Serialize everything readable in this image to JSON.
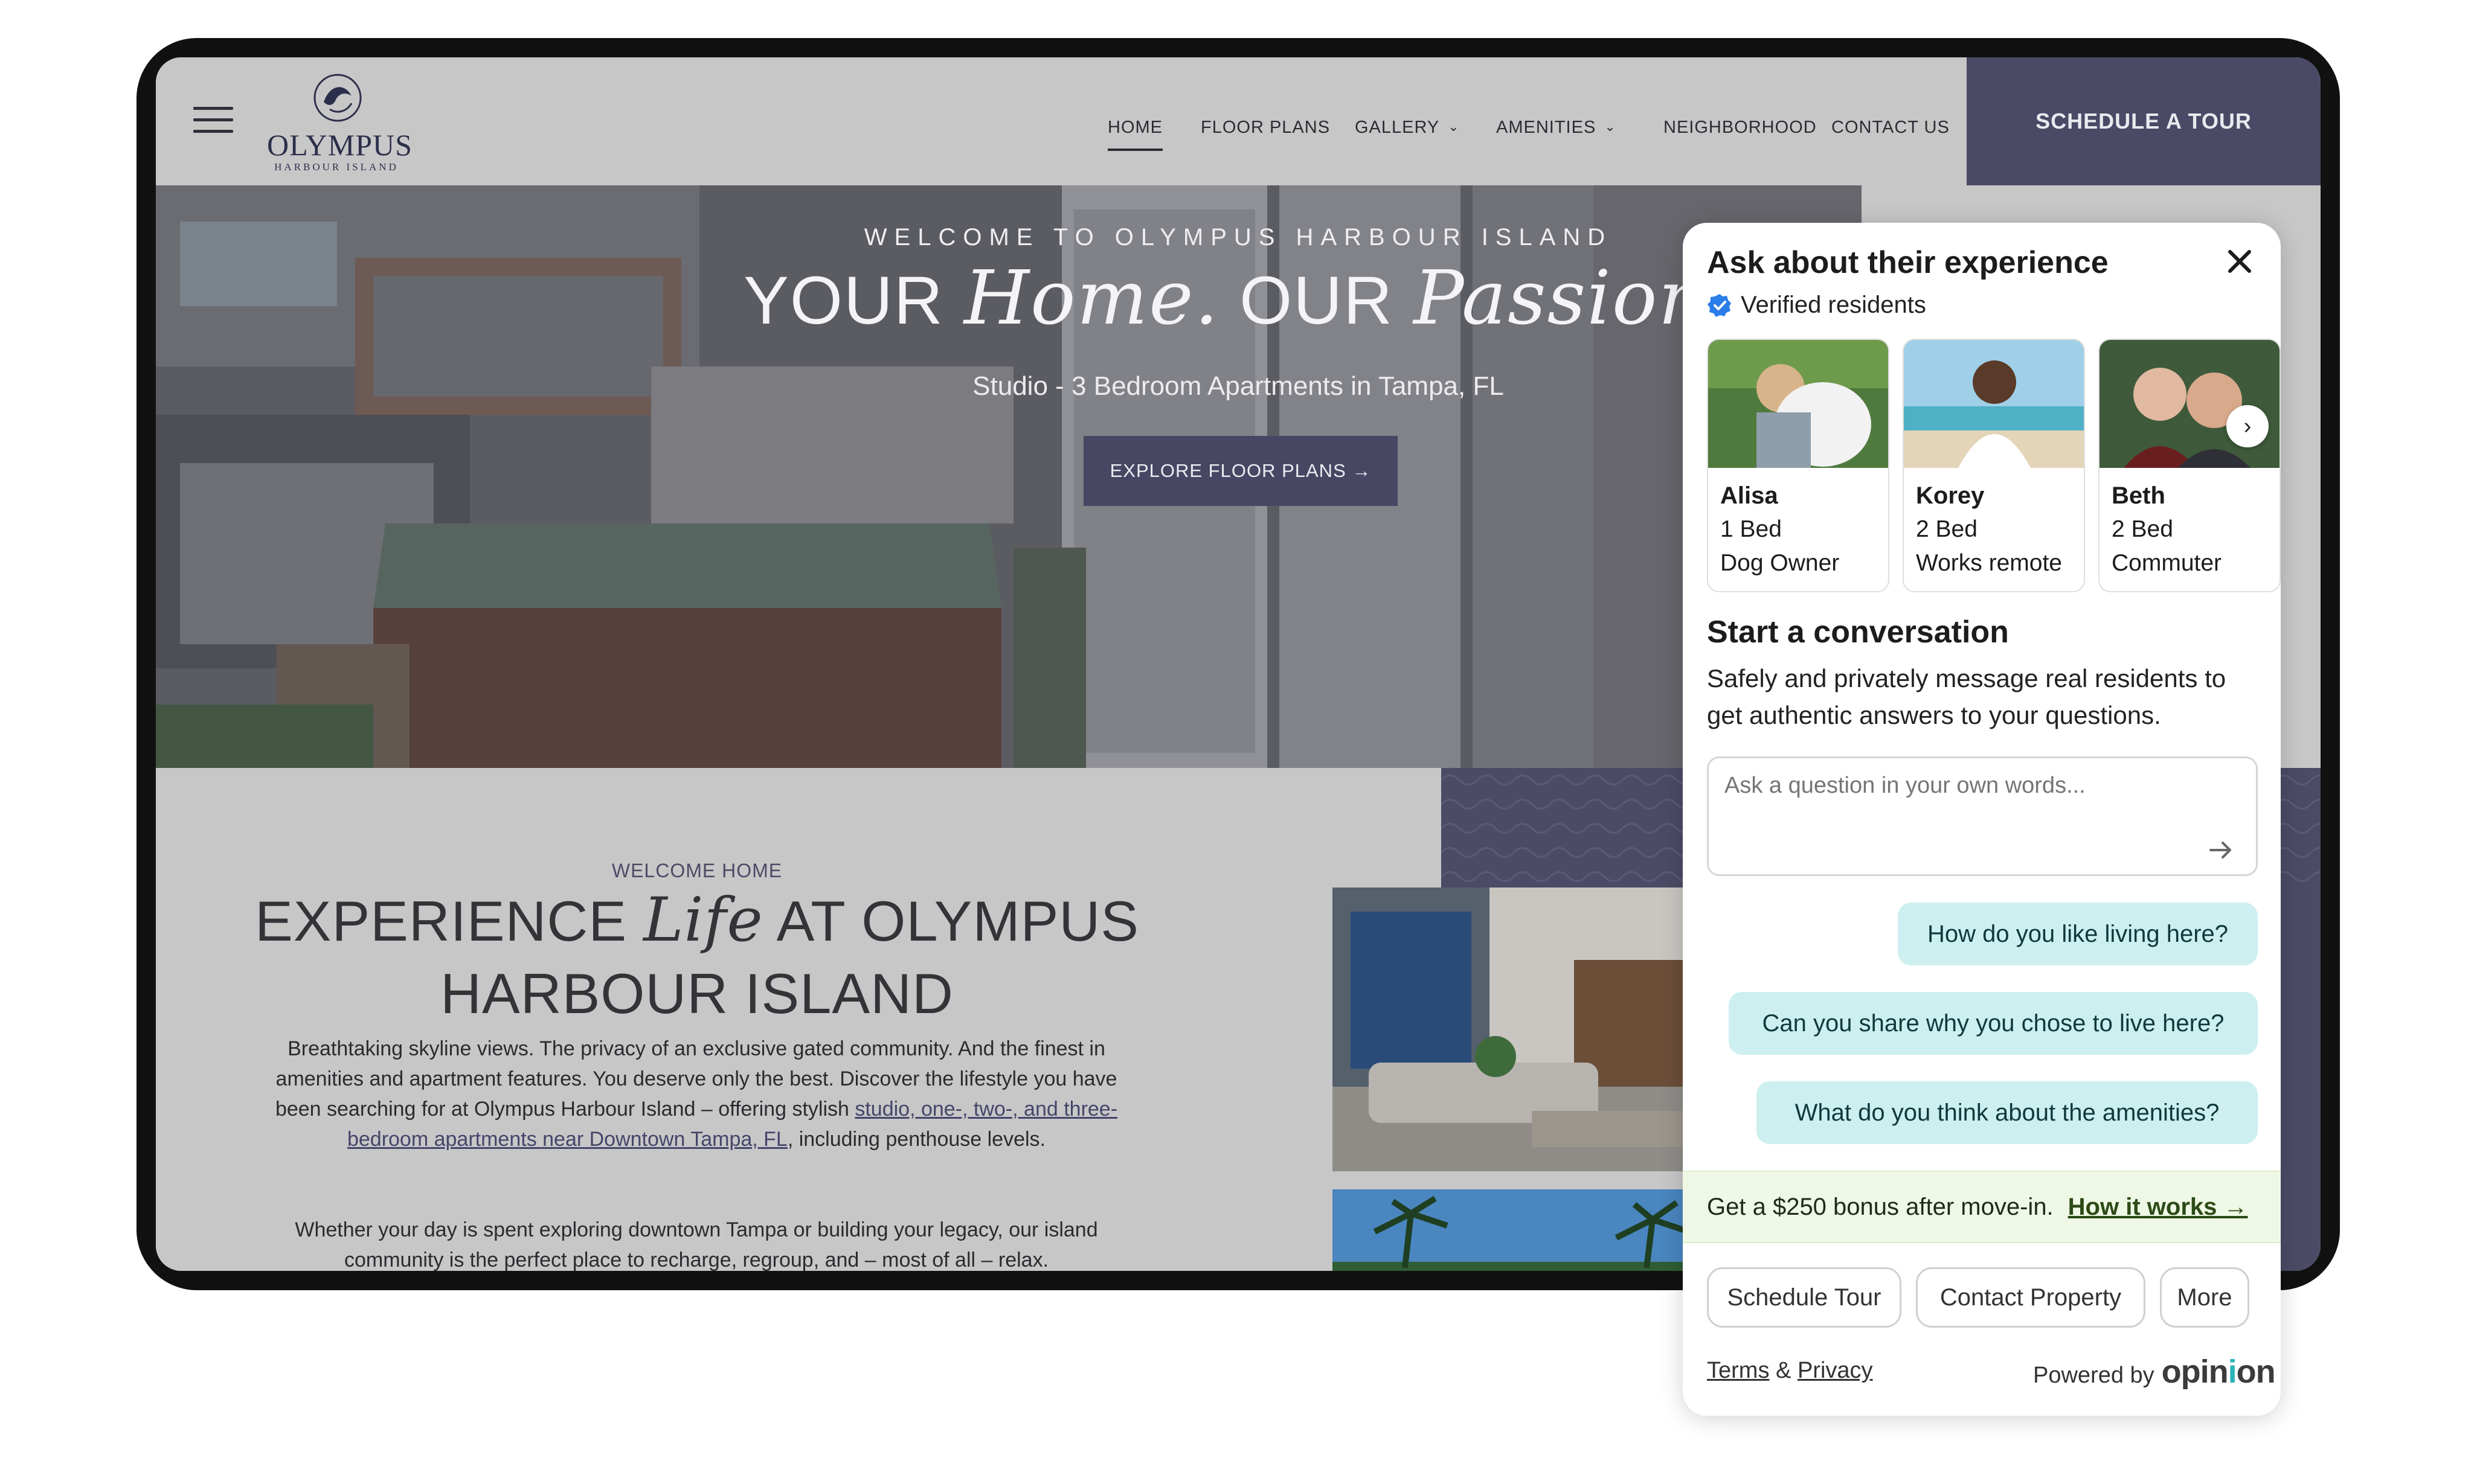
{
  "header": {
    "logo_name": "OLYMPUS",
    "logo_sub": "HARBOUR ISLAND",
    "nav": [
      {
        "label": "HOME",
        "active": true
      },
      {
        "label": "FLOOR PLANS"
      },
      {
        "label": "GALLERY",
        "dropdown": true
      },
      {
        "label": "AMENITIES",
        "dropdown": true
      },
      {
        "label": "NEIGHBORHOOD"
      },
      {
        "label": "CONTACT US"
      }
    ],
    "cta": "SCHEDULE A TOUR"
  },
  "hero": {
    "pretitle": "WELCOME TO OLYMPUS HARBOUR ISLAND",
    "title_part1": "YOUR ",
    "title_script1": "Home.",
    "title_part2": " OUR ",
    "title_script2": "Passion.",
    "subtitle": "Studio - 3 Bedroom Apartments in Tampa, FL",
    "cta": "EXPLORE FLOOR PLANS →"
  },
  "welcome": {
    "label": "WELCOME HOME",
    "title_part1": "EXPERIENCE ",
    "title_script": "Life",
    "title_part2": " AT OLYMPUS",
    "title_line2": "HARBOUR ISLAND",
    "body_pre": "Breathtaking skyline views. The privacy of an exclusive gated community. And the finest in amenities and apartment features. You deserve only the best. Discover the lifestyle you have been searching for at Olympus Harbour Island – offering stylish ",
    "body_link": "studio, one-, two-, and three-bedroom apartments near Downtown Tampa, FL",
    "body_post": ", including penthouse levels.",
    "body2": "Whether your day is spent exploring downtown Tampa or building your legacy, our island community is the perfect place to recharge, regroup, and – most of all – relax."
  },
  "widget": {
    "title": "Ask about their experience",
    "verified": "Verified residents",
    "residents": [
      {
        "name": "Alisa",
        "beds": "1 Bed",
        "tag": "Dog Owner"
      },
      {
        "name": "Korey",
        "beds": "2 Bed",
        "tag": "Works remote"
      },
      {
        "name": "Beth",
        "beds": "2 Bed",
        "tag": "Commuter"
      }
    ],
    "start_title": "Start a conversation",
    "start_desc": "Safely and privately message real residents to get authentic answers to your questions.",
    "input_placeholder": "Ask a question in your own words...",
    "suggestions": [
      "How do you like living here?",
      "Can you share why you chose to live here?",
      "What do you think about the amenities?"
    ],
    "bonus_text": "Get a $250 bonus after move-in.",
    "bonus_link": "How it works →",
    "actions": [
      "Schedule Tour",
      "Contact Property",
      "More"
    ],
    "terms": "Terms",
    "amp": "&",
    "privacy": "Privacy",
    "powered_by": "Powered by",
    "brand_pre": "opin",
    "brand_mid": "i",
    "brand_post": "on"
  },
  "colors": {
    "brand_navy": "#4a4a66",
    "page_gray": "#c8c7c8",
    "suggestion_bg": "#cdeff0",
    "bonus_bg": "#eef8e4",
    "verified_blue": "#2b7de9"
  }
}
